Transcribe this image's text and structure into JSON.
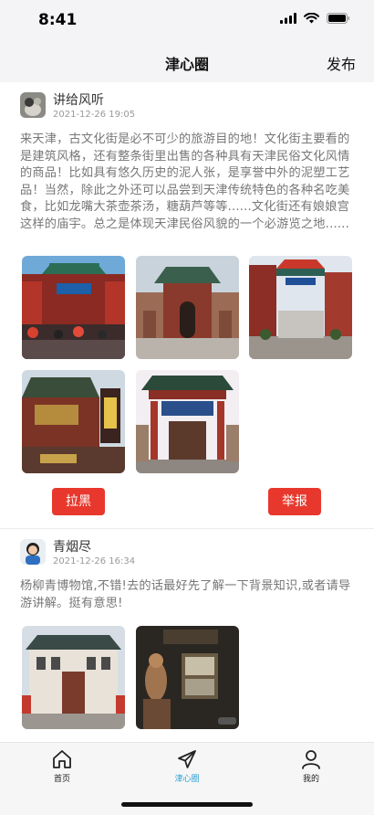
{
  "status": {
    "time": "8:41"
  },
  "header": {
    "title": "津心圈",
    "publish_label": "发布"
  },
  "posts": [
    {
      "user": "讲给风听",
      "time": "2021-12-26 19:05",
      "text": "来天津，古文化街是必不可少的旅游目的地！文化街主要看的是建筑风格，还有整条街里出售的各种具有天津民俗文化风情的商品！比如具有悠久历史的泥人张，是享誉中外的泥塑工艺品！当然，除此之外还可以品尝到天津传统特色的各种名吃美食，比如龙嘴大茶壶茶汤，糖葫芦等等......文化街还有娘娘宫这样的庙宇。总之是体现天津民俗风貌的一个必游览之地......",
      "photos": [
        "culture-street-gate-crowd",
        "culture-street-temple-gate",
        "culture-street-archway",
        "opera-building",
        "pagoda-gate"
      ],
      "block_label": "拉黑",
      "report_label": "举报"
    },
    {
      "user": "青烟尽",
      "time": "2021-12-26 16:34",
      "text": "杨柳青博物馆,不错!去的话最好先了解一下背景知识,或者请导游讲解。挺有意思!",
      "photos": [
        "museum-building",
        "museum-exhibit"
      ]
    }
  ],
  "tabs": [
    {
      "label": "首页",
      "icon": "home-icon"
    },
    {
      "label": "津心圈",
      "icon": "paper-plane-icon",
      "active": true
    },
    {
      "label": "我的",
      "icon": "person-icon"
    }
  ],
  "colors": {
    "accent": "#e8382d",
    "tab_active": "#2a9fd6"
  }
}
